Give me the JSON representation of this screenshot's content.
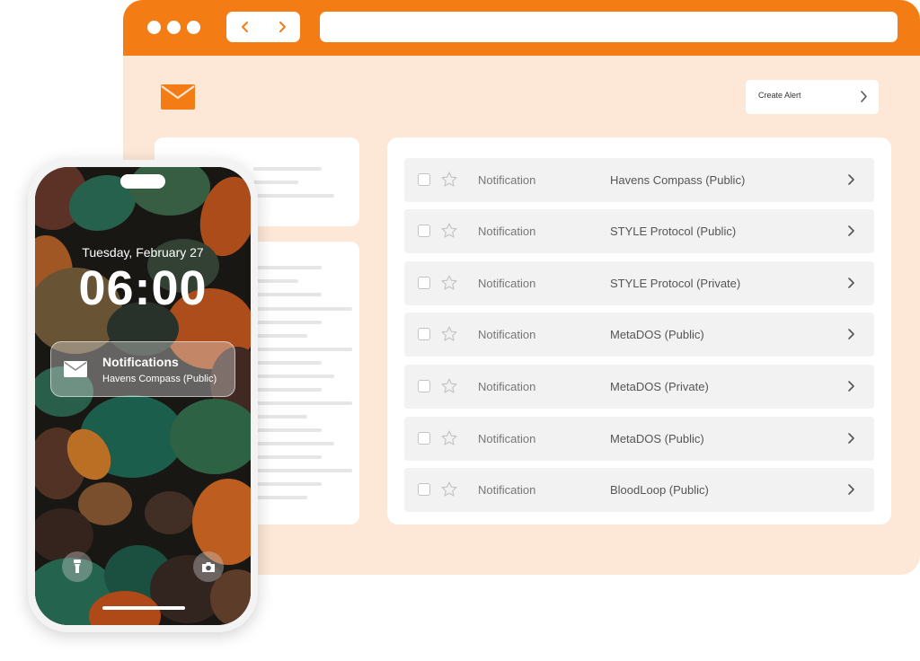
{
  "browser": {
    "create_alert_label": "Create Alert"
  },
  "notifications": [
    {
      "type": "Notification",
      "title": "Havens Compass (Public)"
    },
    {
      "type": "Notification",
      "title": "STYLE Protocol (Public)"
    },
    {
      "type": "Notification",
      "title": "STYLE Protocol (Private)"
    },
    {
      "type": "Notification",
      "title": "MetaDOS (Public)"
    },
    {
      "type": "Notification",
      "title": "MetaDOS (Private)"
    },
    {
      "type": "Notification",
      "title": "MetaDOS (Public)"
    },
    {
      "type": "Notification",
      "title": "BloodLoop (Public)"
    }
  ],
  "phone": {
    "date": "Tuesday, February 27",
    "time": "06:00",
    "notification": {
      "title": "Notifications",
      "subtitle": "Havens Compass (Public)"
    },
    "icons": {
      "left_quick_action": "flashlight-icon",
      "right_quick_action": "camera-icon",
      "notification_icon": "mail-icon"
    }
  },
  "colors": {
    "accent": "#f47c14",
    "background": "#fde7d6"
  }
}
